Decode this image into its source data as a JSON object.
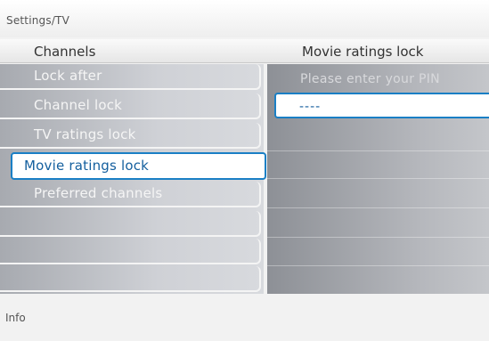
{
  "breadcrumb": "Settings/TV",
  "header": {
    "left_title": "Channels",
    "right_title": "Movie ratings lock"
  },
  "menu": {
    "items": [
      {
        "label": "Lock after",
        "selected": false
      },
      {
        "label": "Channel lock",
        "selected": false
      },
      {
        "label": "TV ratings lock",
        "selected": false
      },
      {
        "label": "Movie ratings lock",
        "selected": true
      },
      {
        "label": "Preferred channels",
        "selected": false
      },
      {
        "label": "",
        "selected": false
      },
      {
        "label": "",
        "selected": false
      },
      {
        "label": "",
        "selected": false
      }
    ]
  },
  "pin_panel": {
    "prompt": "Please enter your PIN",
    "pin_value": "----"
  },
  "footer": {
    "info_label": "Info"
  },
  "colors": {
    "accent": "#1a7fc5",
    "selected_text": "#145f9e"
  }
}
